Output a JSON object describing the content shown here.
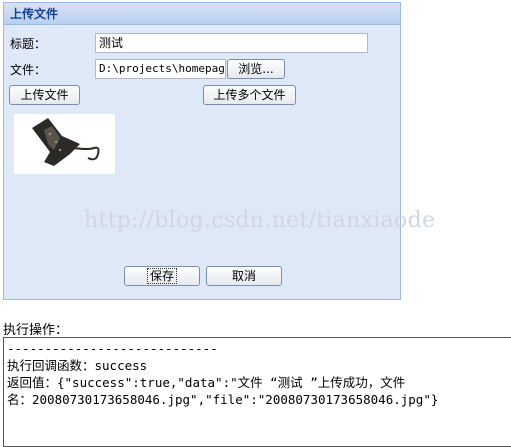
{
  "panel": {
    "title": "上传文件",
    "title_label": "标题：",
    "title_value": "测试",
    "file_label": "文件：",
    "file_value": "D:\\projects\\homepage\\",
    "browse_label": "浏览...",
    "upload_button": "上传文件",
    "upload_multi_button": "上传多个文件",
    "save_button": "保存",
    "cancel_button": "取消"
  },
  "watermark": "http://blog.csdn.net/tianxiaode",
  "exec": {
    "title": "执行操作：",
    "lines": [
      "----------------------------",
      "执行回调函数：success",
      "返回值：{\"success\":true,\"data\":\"文件 “测试 ”上传成功，文件",
      "名：20080730173658046.jpg\",\"file\":\"20080730173658046.jpg\"}"
    ]
  },
  "icons": {
    "preview": "stingray-image"
  }
}
